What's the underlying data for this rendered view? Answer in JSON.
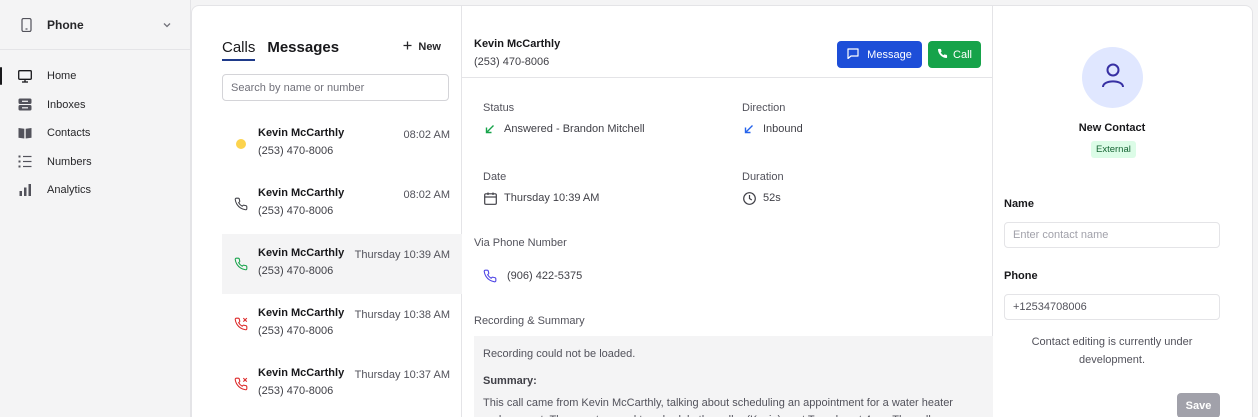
{
  "sidebar": {
    "app_switcher": {
      "label": "Phone",
      "icon": "phone-device-icon"
    },
    "items": [
      {
        "label": "Home",
        "icon": "monitor-icon",
        "active": true
      },
      {
        "label": "Inboxes",
        "icon": "inbox-icon"
      },
      {
        "label": "Contacts",
        "icon": "book-icon"
      },
      {
        "label": "Numbers",
        "icon": "list-icon"
      },
      {
        "label": "Analytics",
        "icon": "bar-chart-icon"
      }
    ]
  },
  "calls_panel": {
    "tabs": [
      {
        "label": "Calls",
        "active": true
      },
      {
        "label": "Messages"
      }
    ],
    "new_label": "New",
    "search_placeholder": "Search by name or number",
    "calls": [
      {
        "name": "Kevin McCarthly",
        "phone": "(253) 470-8006",
        "time": "08:02 AM",
        "icon": "status-dot-icon"
      },
      {
        "name": "Kevin McCarthly",
        "phone": "(253) 470-8006",
        "time": "08:02 AM",
        "icon": "phone-icon"
      },
      {
        "name": "Kevin McCarthly",
        "phone": "(253) 470-8006",
        "time": "Thursday 10:39 AM",
        "icon": "phone-answered-icon",
        "selected": true
      },
      {
        "name": "Kevin McCarthly",
        "phone": "(253) 470-8006",
        "time": "Thursday 10:38 AM",
        "icon": "phone-missed-icon"
      },
      {
        "name": "Kevin McCarthly",
        "phone": "(253) 470-8006",
        "time": "Thursday 10:37 AM",
        "icon": "phone-missed-icon"
      }
    ]
  },
  "detail": {
    "name": "Kevin McCarthly",
    "phone": "(253) 470-8006",
    "message_label": "Message",
    "call_label": "Call",
    "status_label": "Status",
    "status_value": "Answered - Brandon Mitchell",
    "direction_label": "Direction",
    "direction_value": "Inbound",
    "date_label": "Date",
    "date_value": "Thursday 10:39 AM",
    "duration_label": "Duration",
    "duration_value": "52s",
    "via_label": "Via Phone Number",
    "via_value": "(906) 422-5375",
    "recording_label": "Recording & Summary",
    "recording_message": "Recording could not be loaded.",
    "summary_label": "Summary:",
    "summary_text": "This call came from Kevin McCarthly, talking about scheduling an appointment for a water heater replacement. The agent agreed to schedule the caller (Kevin) next Tuesday at 4pm. The caller"
  },
  "contact": {
    "name": "New Contact",
    "badge": "External",
    "name_label": "Name",
    "name_placeholder": "Enter contact name",
    "phone_label": "Phone",
    "phone_value": "+12534708006",
    "note": "Contact editing is currently under development.",
    "save_label": "Save"
  },
  "colors": {
    "primary_blue": "#1d4ed8",
    "call_green": "#16a34a",
    "missed_red": "#dc2626",
    "avatar_bg": "#e0e7ff",
    "badge_bg": "#dcfce7",
    "badge_text": "#166534"
  }
}
